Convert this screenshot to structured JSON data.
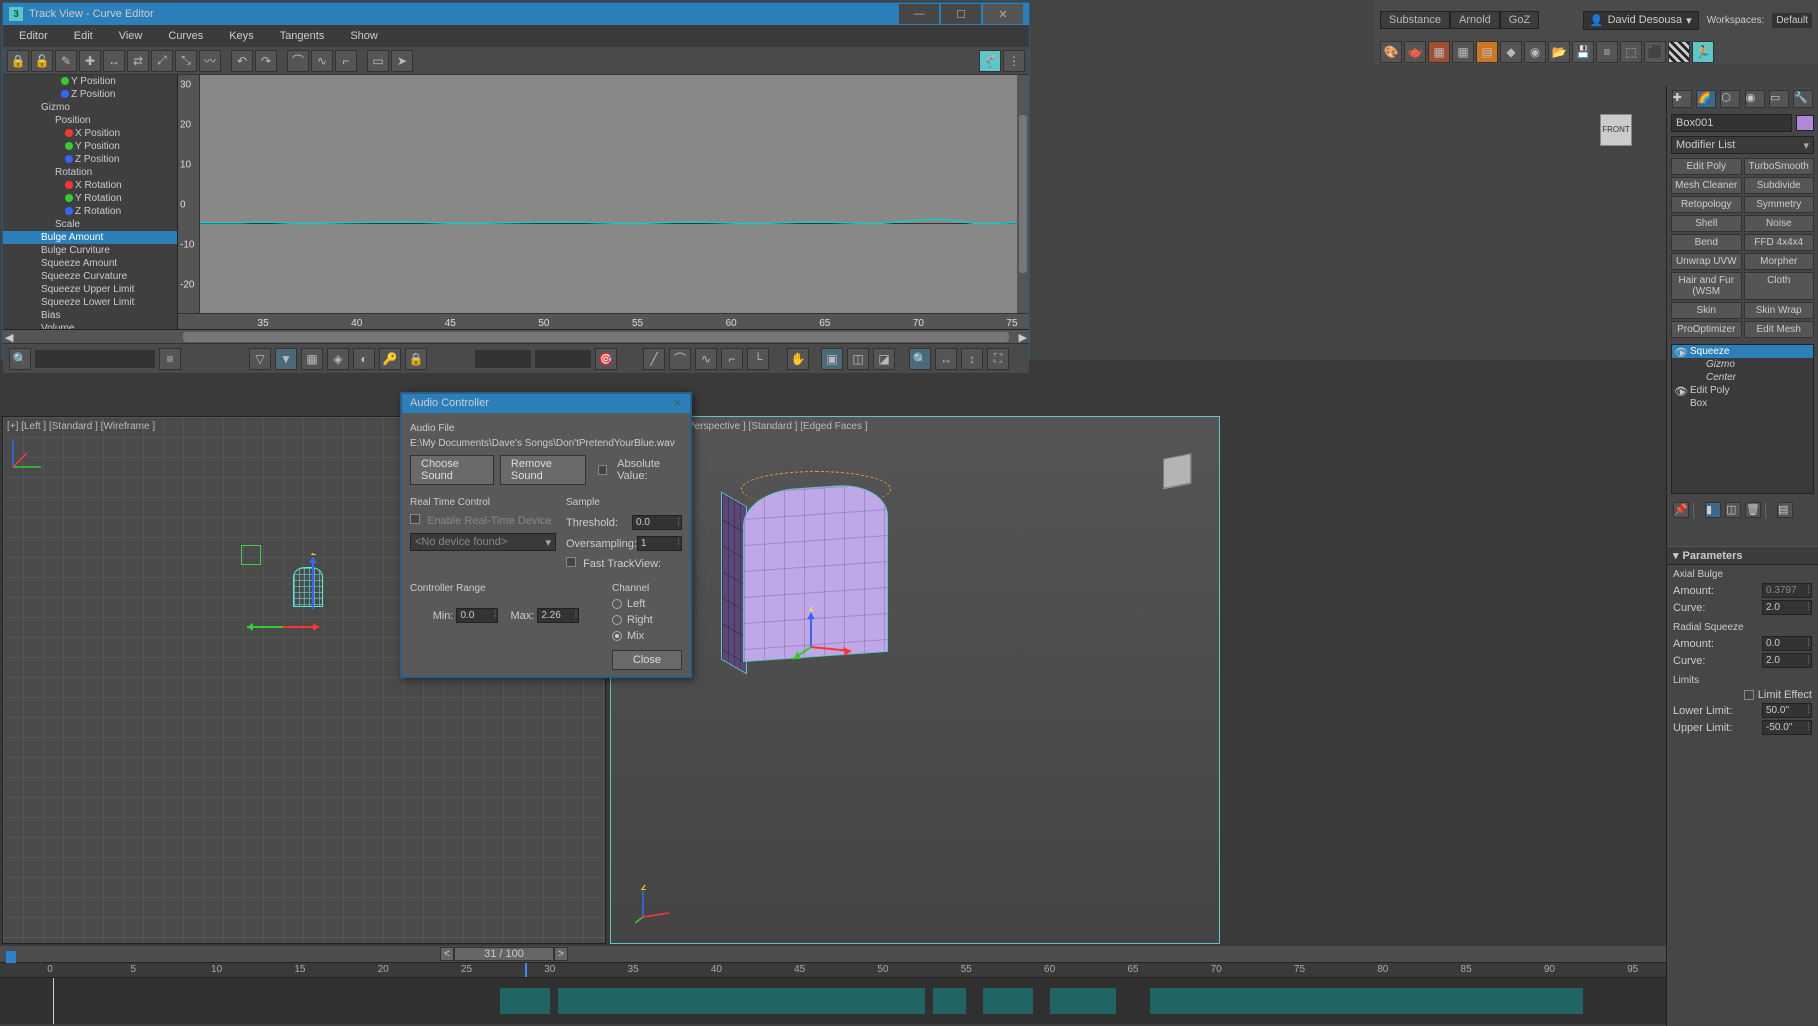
{
  "main_tabs": [
    "Substance",
    "Arnold",
    "GoZ"
  ],
  "user_name": "David Desousa",
  "workspace_label": "Workspaces:",
  "workspace_value": "Default",
  "curve_editor": {
    "title": "Track View - Curve Editor",
    "menus": [
      "Editor",
      "Edit",
      "View",
      "Curves",
      "Keys",
      "Tangents",
      "Show"
    ],
    "tree": [
      {
        "label": "Y Position",
        "indent": 58,
        "color": "#3c3"
      },
      {
        "label": "Z Position",
        "indent": 58,
        "color": "#36f"
      },
      {
        "label": "Gizmo",
        "indent": 38,
        "color": null
      },
      {
        "label": "Position",
        "indent": 52,
        "color": null
      },
      {
        "label": "X Position",
        "indent": 62,
        "color": "#f33"
      },
      {
        "label": "Y Position",
        "indent": 62,
        "color": "#3c3"
      },
      {
        "label": "Z Position",
        "indent": 62,
        "color": "#36f"
      },
      {
        "label": "Rotation",
        "indent": 52,
        "color": null
      },
      {
        "label": "X Rotation",
        "indent": 62,
        "color": "#f33"
      },
      {
        "label": "Y Rotation",
        "indent": 62,
        "color": "#3c3"
      },
      {
        "label": "Z Rotation",
        "indent": 62,
        "color": "#36f"
      },
      {
        "label": "Scale",
        "indent": 52,
        "color": null
      },
      {
        "label": "Bulge Amount",
        "indent": 38,
        "color": null,
        "sel": true
      },
      {
        "label": "Bulge Curviture",
        "indent": 38,
        "color": null
      },
      {
        "label": "Squeeze Amount",
        "indent": 38,
        "color": null
      },
      {
        "label": "Squeeze Curvature",
        "indent": 38,
        "color": null
      },
      {
        "label": "Squeeze Upper Limit",
        "indent": 38,
        "color": null
      },
      {
        "label": "Squeeze Lower Limit",
        "indent": 38,
        "color": null
      },
      {
        "label": "Bias",
        "indent": 38,
        "color": null
      },
      {
        "label": "Volume",
        "indent": 38,
        "color": null
      }
    ],
    "v_ticks": [
      "30",
      "20",
      "10",
      "0",
      "-10",
      "-20"
    ],
    "h_ticks": [
      "35",
      "40",
      "45",
      "50",
      "55",
      "60",
      "65",
      "70",
      "75"
    ]
  },
  "viewports": {
    "left_label": "[+] [Left ] [Standard ] [Wireframe ]",
    "right_label": "[+] [Perspective ] [Standard ] [Edged Faces ]"
  },
  "dialog": {
    "title": "Audio Controller",
    "audio_file_label": "Audio File",
    "audio_path": "E:\\My Documents\\Dave's Songs\\Don'tPretendYourBlue.wav",
    "choose_sound": "Choose Sound",
    "remove_sound": "Remove Sound",
    "absolute_value": "Absolute Value:",
    "rtc_label": "Real Time Control",
    "enable_rtc": "Enable Real-Time Device",
    "no_device": "<No device found>",
    "sample_label": "Sample",
    "threshold_label": "Threshold:",
    "threshold_val": "0.0",
    "oversampling_label": "Oversampling:",
    "oversampling_val": "1",
    "fast_tv": "Fast TrackView:",
    "range_label": "Controller Range",
    "min_label": "Min:",
    "min_val": "0.0",
    "max_label": "Max:",
    "max_val": "2.26",
    "channel_label": "Channel",
    "left": "Left",
    "right": "Right",
    "mix": "Mix",
    "close": "Close"
  },
  "command_panel": {
    "object_name": "Box001",
    "modifier_list_label": "Modifier List",
    "mod_buttons": [
      "Edit Poly",
      "TurboSmooth",
      "Mesh Cleaner",
      "Subdivide",
      "Retopology",
      "Symmetry",
      "Shell",
      "Noise",
      "Bend",
      "FFD 4x4x4",
      "Unwrap UVW",
      "Morpher",
      "Hair and Fur (WSM",
      "Cloth",
      "Skin",
      "Skin Wrap",
      "ProOptimizer",
      "Edit Mesh"
    ],
    "stack": [
      {
        "label": "Squeeze",
        "indent": 18,
        "sel": true,
        "eye": true,
        "arrow": true
      },
      {
        "label": "Gizmo",
        "indent": 34,
        "italic": true
      },
      {
        "label": "Center",
        "indent": 34,
        "italic": true
      },
      {
        "label": "Edit Poly",
        "indent": 18,
        "eye": true,
        "arrow": true
      },
      {
        "label": "Box",
        "indent": 18
      }
    ],
    "params_header": "Parameters",
    "axial_label": "Axial Bulge",
    "amount_label": "Amount:",
    "axial_amount": "0.3797",
    "curve_label": "Curve:",
    "axial_curve": "2.0",
    "radial_label": "Radial Squeeze",
    "radial_amount": "0.0",
    "radial_curve": "2.0",
    "limits_label": "Limits",
    "limit_effect": "Limit Effect",
    "lower_limit_label": "Lower Limit:",
    "lower_limit": "50.0\"",
    "upper_limit_label": "Upper Limit:",
    "upper_limit": "-50.0\""
  },
  "timeline": {
    "frame_display": "31 / 100",
    "ticks": [
      "0",
      "5",
      "10",
      "15",
      "20",
      "25",
      "30",
      "35",
      "40",
      "45",
      "50",
      "55",
      "60",
      "65",
      "70",
      "75",
      "80",
      "85",
      "90",
      "95"
    ]
  }
}
